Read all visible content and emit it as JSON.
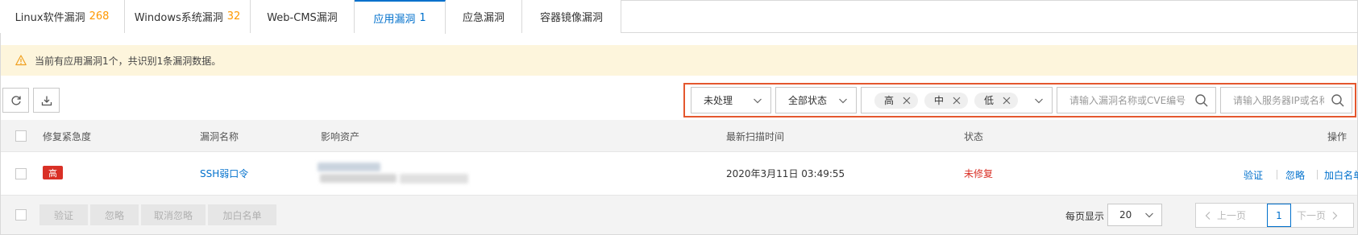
{
  "tabs": [
    {
      "label": "Linux软件漏洞",
      "count": "268"
    },
    {
      "label": "Windows系统漏洞",
      "count": "32"
    },
    {
      "label": "Web-CMS漏洞",
      "count": ""
    },
    {
      "label": "应用漏洞",
      "count": "1"
    },
    {
      "label": "应急漏洞",
      "count": ""
    },
    {
      "label": "容器镜像漏洞",
      "count": ""
    }
  ],
  "alert": {
    "text": "当前有应用漏洞1个，共识别1条漏洞数据。"
  },
  "filters": {
    "status_select": "未处理",
    "all_status_select": "全部状态",
    "levels": [
      "高",
      "中",
      "低"
    ],
    "search_vuln_placeholder": "请输入漏洞名称或CVE编号",
    "search_server_placeholder": "请输入服务器IP或名称"
  },
  "table": {
    "headers": [
      "修复紧急度",
      "漏洞名称",
      "影响资产",
      "最新扫描时间",
      "状态",
      "操作"
    ],
    "rows": [
      {
        "urgency": "高",
        "name": "SSH弱口令",
        "scan_time": "2020年3月11日 03:49:55",
        "status": "未修复",
        "actions": [
          "验证",
          "忽略",
          "加白名单"
        ]
      }
    ]
  },
  "footer": {
    "buttons": [
      "验证",
      "忽略",
      "取消忽略",
      "加白名单"
    ],
    "page_size_label": "每页显示",
    "page_size": "20",
    "prev": "上一页",
    "current_page": "1",
    "next": "下一页"
  },
  "colors": {
    "accent": "#0070cc",
    "danger": "#d93026",
    "warning": "#ff9800",
    "highlight_border": "#e4572e"
  }
}
